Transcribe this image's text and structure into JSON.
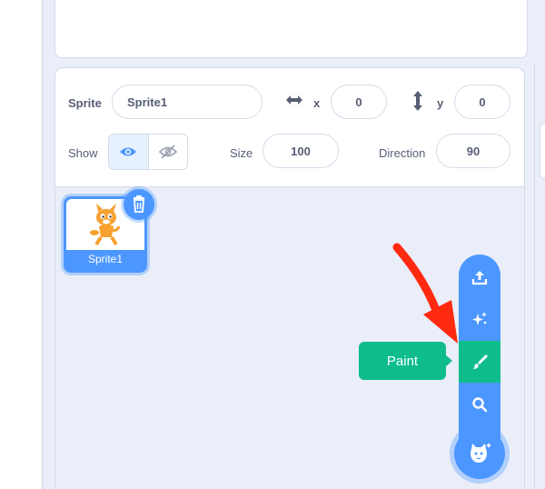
{
  "sprite_info": {
    "sprite_label": "Sprite",
    "sprite_name": "Sprite1",
    "x_label": "x",
    "x_value": "0",
    "y_label": "y",
    "y_value": "0",
    "show_label": "Show",
    "size_label": "Size",
    "size_value": "100",
    "direction_label": "Direction",
    "direction_value": "90"
  },
  "sprites": [
    {
      "name": "Sprite1"
    }
  ],
  "add_sprite_menu": {
    "items": [
      "upload-icon",
      "surprise-icon",
      "paint-icon",
      "search-icon"
    ],
    "active_item": "paint-icon",
    "tooltip": "Paint"
  },
  "colors": {
    "primary_blue": "#4c97ff",
    "active_green": "#0fbd8c",
    "text": "#575e75",
    "annotation_red": "#ff2a10"
  }
}
